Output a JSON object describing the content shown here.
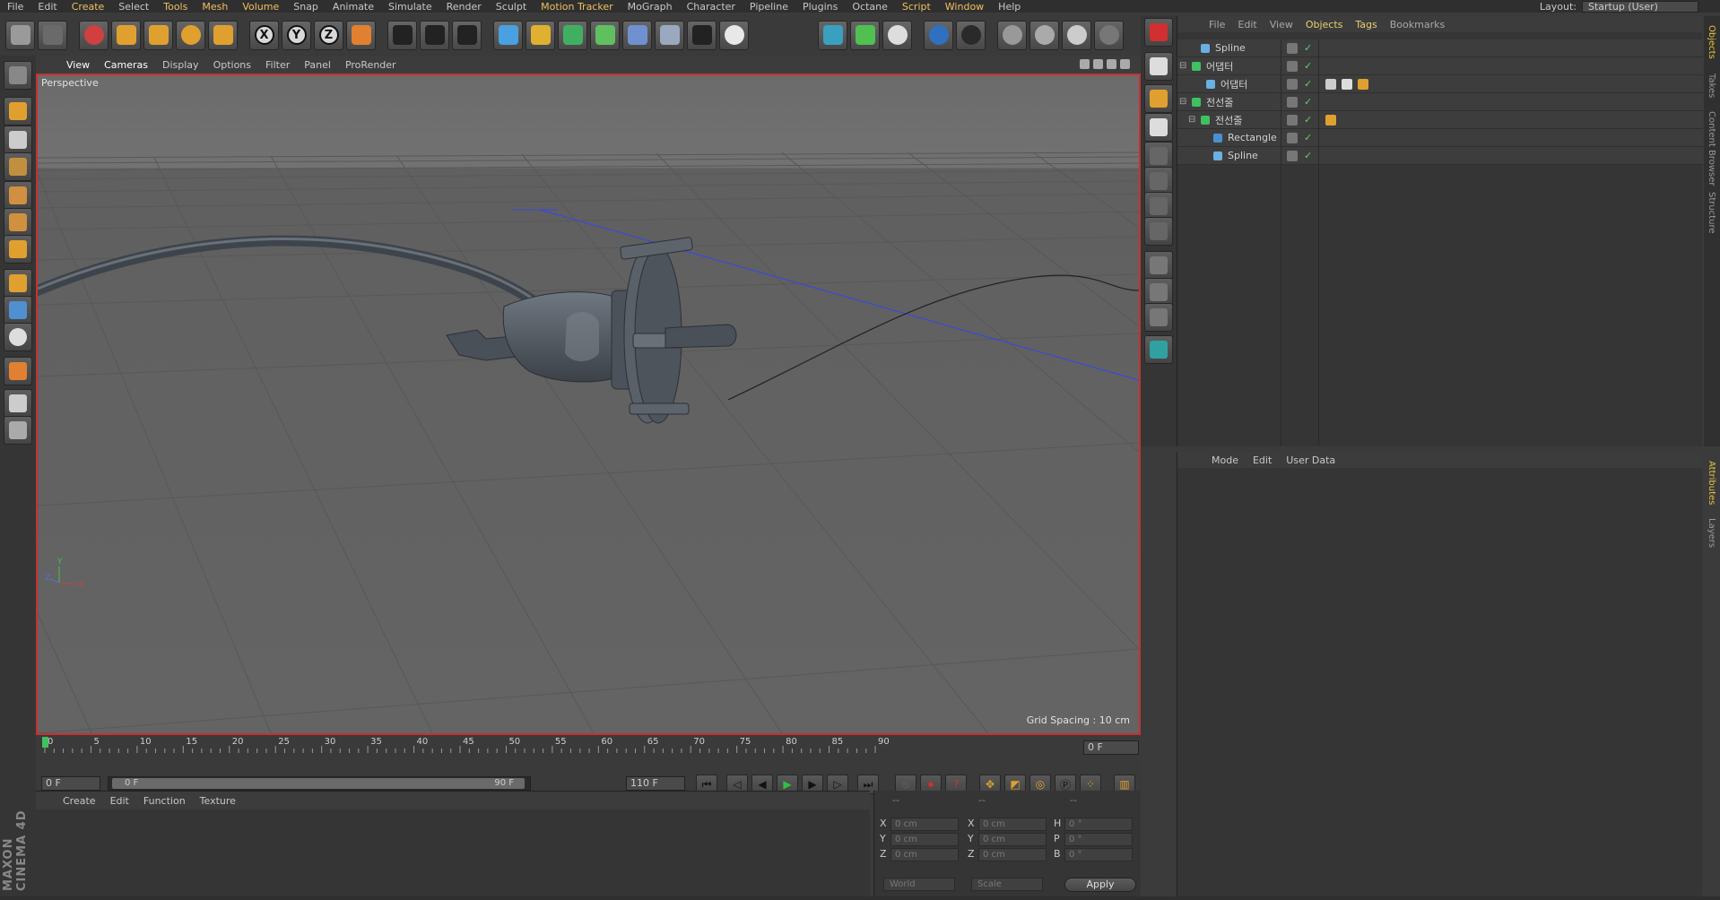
{
  "menu": [
    "File",
    "Edit",
    "Create",
    "Select",
    "Tools",
    "Mesh",
    "Volume",
    "Snap",
    "Animate",
    "Simulate",
    "Render",
    "Sculpt",
    "Motion Tracker",
    "MoGraph",
    "Character",
    "Pipeline",
    "Plugins",
    "Octane",
    "Script",
    "Window",
    "Help"
  ],
  "menu_highlight": [
    "Create",
    "Mesh",
    "Volume",
    "Tools",
    "Motion Tracker",
    "Script",
    "Window"
  ],
  "layout": {
    "label": "Layout:",
    "value": "Startup (User)"
  },
  "viewport_menu": [
    "View",
    "Cameras",
    "Display",
    "Options",
    "Filter",
    "Panel",
    "ProRender"
  ],
  "viewport": {
    "label": "Perspective",
    "grid_spacing": "Grid Spacing : 10 cm",
    "axis": {
      "x": "X",
      "y": "Y",
      "z": "Z"
    }
  },
  "toolbar": {
    "axis_x": "X",
    "axis_y": "Y",
    "axis_z": "Z"
  },
  "object_manager": {
    "menu": [
      "File",
      "Edit",
      "View",
      "Objects",
      "Tags",
      "Bookmarks"
    ],
    "objects": [
      {
        "name": "Spline",
        "icon": "spline-icon"
      },
      {
        "name": "어댑터",
        "icon": "null-icon"
      },
      {
        "name": "어댑터",
        "icon": "mesh-icon"
      },
      {
        "name": "전선줄",
        "icon": "null-icon"
      },
      {
        "name": "전선줄",
        "icon": "sweep-icon"
      },
      {
        "name": "Rectangle",
        "icon": "rectangle-icon"
      },
      {
        "name": "Spline",
        "icon": "spline-icon"
      }
    ]
  },
  "side_tabs": [
    "Objects",
    "Takes",
    "Content Browser",
    "Structure"
  ],
  "attr_tabs": [
    "Attributes",
    "Layers"
  ],
  "attribute_manager": {
    "menu": [
      "Mode",
      "Edit",
      "User Data"
    ]
  },
  "timeline": {
    "ticks": [
      "0",
      "5",
      "10",
      "15",
      "20",
      "25",
      "30",
      "35",
      "40",
      "45",
      "50",
      "55",
      "60",
      "65",
      "70",
      "75",
      "80",
      "85",
      "90"
    ],
    "current_frame": "0 F",
    "frame_field": "0 F"
  },
  "transport": {
    "start": "0 F",
    "range_start": "0 F",
    "range_end": "90 F",
    "end": "110 F"
  },
  "material_manager": {
    "menu": [
      "Create",
      "Edit",
      "Function",
      "Texture"
    ]
  },
  "coordinates": {
    "headers": [
      "--",
      "--",
      "--"
    ],
    "rows": [
      {
        "l1": "X",
        "v1": "0 cm",
        "l2": "X",
        "v2": "0 cm",
        "l3": "H",
        "v3": "0 °"
      },
      {
        "l1": "Y",
        "v1": "0 cm",
        "l2": "Y",
        "v2": "0 cm",
        "l3": "P",
        "v3": "0 °"
      },
      {
        "l1": "Z",
        "v1": "0 cm",
        "l2": "Z",
        "v2": "0 cm",
        "l3": "B",
        "v3": "0 °"
      }
    ],
    "space": "World",
    "mode": "Scale",
    "apply": "Apply"
  },
  "logo": "MAXON CINEMA 4D",
  "colors": {
    "accent": "#e8c040",
    "active_border": "#c83030",
    "playhead": "#40c060"
  }
}
